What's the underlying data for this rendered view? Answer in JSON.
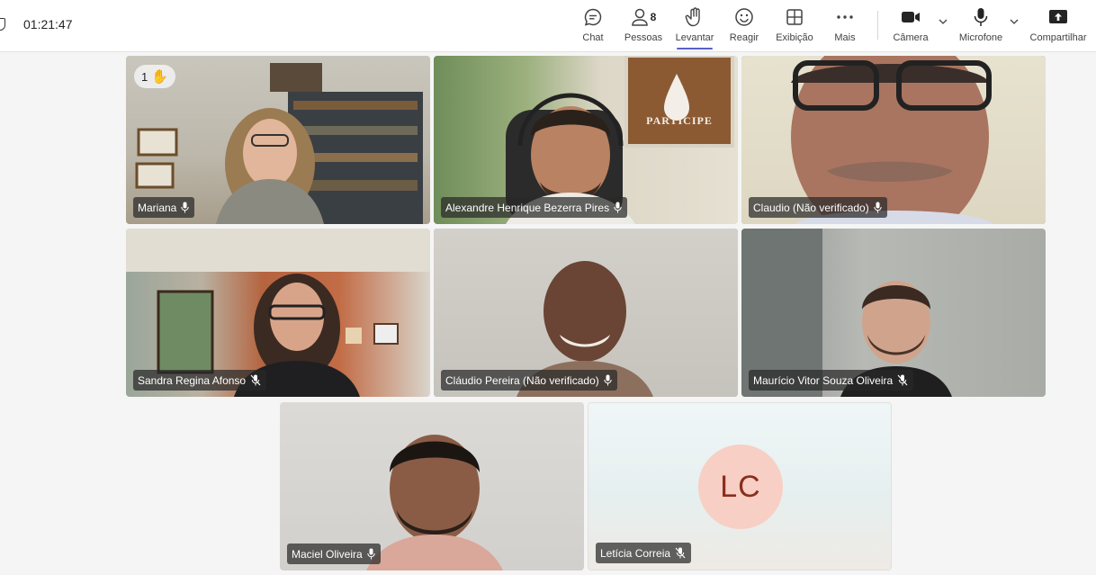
{
  "header": {
    "timer": "01:21:47",
    "toolbar": {
      "chat": "Chat",
      "people": "Pessoas",
      "people_count": "8",
      "raise": "Levantar",
      "react": "Reagir",
      "view": "Exibição",
      "more": "Mais",
      "camera": "Câmera",
      "mic": "Microfone",
      "share": "Compartilhar"
    }
  },
  "participants": [
    {
      "name": "Mariana",
      "mic": "on",
      "raised_hand_count": "1",
      "speaking": true
    },
    {
      "name": "Alexandre Henrique Bezerra Pires",
      "mic": "on"
    },
    {
      "name": "Claudio (Não verificado)",
      "mic": "on",
      "speaking": true
    },
    {
      "name": "Sandra Regina Afonso",
      "mic": "muted"
    },
    {
      "name": "Cláudio Pereira (Não verificado)",
      "mic": "on",
      "speaking": true
    },
    {
      "name": "Maurício Vitor Souza Oliveira",
      "mic": "muted"
    },
    {
      "name": "Maciel Oliveira",
      "mic": "on"
    },
    {
      "name": "Letícia Correia",
      "mic": "muted",
      "initials": "LC",
      "avatar_color": "#f7cfc4"
    }
  ],
  "poster_text": "PARTICIPE",
  "colors": {
    "accent": "#5b5fc7",
    "speaking_border": "#6264a7",
    "raised_hand_border": "#f0b429"
  }
}
